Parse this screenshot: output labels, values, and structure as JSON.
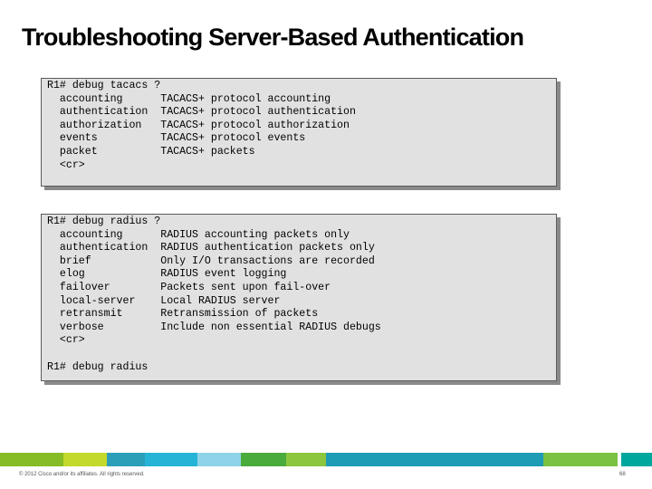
{
  "slide": {
    "title": "Troubleshooting Server-Based Authentication",
    "tacacs_block": "R1# debug tacacs ?\n  accounting      TACACS+ protocol accounting\n  authentication  TACACS+ protocol authentication\n  authorization   TACACS+ protocol authorization\n  events          TACACS+ protocol events\n  packet          TACACS+ packets\n  <cr>",
    "radius_block": "R1# debug radius ?\n  accounting      RADIUS accounting packets only\n  authentication  RADIUS authentication packets only\n  brief           Only I/O transactions are recorded\n  elog            RADIUS event logging\n  failover        Packets sent upon fail-over\n  local-server    Local RADIUS server\n  retransmit      Retransmission of packets\n  verbose         Include non essential RADIUS debugs\n  <cr>\n\nR1# debug radius",
    "footer": "© 2012 Cisco and/or its affiliates. All rights reserved.",
    "page_number": "68"
  },
  "footer_bar_colors": [
    "#86bc25",
    "#c3d92b",
    "#2b9fb8",
    "#26b4d6",
    "#8fd3e8",
    "#4aab3d",
    "#8cc63f",
    "#1e9bb5",
    "#7cc242",
    "#00a79d"
  ]
}
